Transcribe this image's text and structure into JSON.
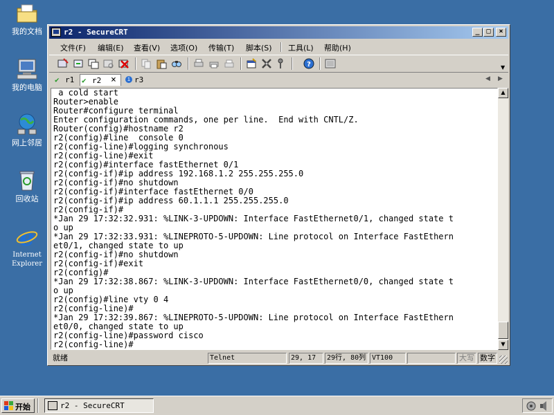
{
  "desktop": {
    "icons": [
      {
        "label": "我的文档",
        "icon": "my-documents-folder-icon"
      },
      {
        "label": "我的电脑",
        "icon": "my-computer-icon"
      },
      {
        "label": "网上邻居",
        "icon": "network-places-icon"
      },
      {
        "label": "回收站",
        "icon": "recycle-bin-icon"
      },
      {
        "label": "Internet Explorer",
        "icon": "internet-explorer-icon"
      }
    ]
  },
  "window": {
    "title": "r2 - SecureCRT",
    "buttons": {
      "minimize": "_",
      "maximize": "□",
      "close": "×"
    },
    "menu": [
      "文件(F)",
      "编辑(E)",
      "查看(V)",
      "选项(O)",
      "传输(T)",
      "脚本(S)",
      "工具(L)",
      "帮助(H)"
    ],
    "toolbar_icons": [
      "connect-icon",
      "quick-connect-icon",
      "connect-in-tab-icon",
      "reconnect-icon",
      "disconnect-icon",
      "copy-icon",
      "paste-icon",
      "find-icon",
      "print-icon",
      "print-selection-icon",
      "print-setup-icon",
      "session-options-icon",
      "global-options-icon",
      "keymap-icon",
      "help-icon",
      "sftp-icon"
    ],
    "tabs": [
      {
        "label": "r1",
        "status": "connected"
      },
      {
        "label": "r2",
        "status": "connected",
        "active": true
      },
      {
        "label": "r3",
        "status": "info"
      }
    ],
    "tab_close": "×",
    "tab_scroll": {
      "left": "◀",
      "right": "▶"
    }
  },
  "terminal": {
    "lines": [
      " a cold start",
      "Router>enable",
      "Router#configure terminal",
      "Enter configuration commands, one per line.  End with CNTL/Z.",
      "Router(config)#hostname r2",
      "r2(config)#line  console 0",
      "r2(config-line)#logging synchronous",
      "r2(config-line)#exit",
      "r2(config)#interface fastEthernet 0/1",
      "r2(config-if)#ip address 192.168.1.2 255.255.255.0",
      "r2(config-if)#no shutdown",
      "r2(config-if)#interface fastEthernet 0/0",
      "r2(config-if)#ip address 60.1.1.1 255.255.255.0",
      "r2(config-if)#",
      "*Jan 29 17:32:32.931: %LINK-3-UPDOWN: Interface FastEthernet0/1, changed state t",
      "o up",
      "*Jan 29 17:32:33.931: %LINEPROTO-5-UPDOWN: Line protocol on Interface FastEthern",
      "et0/1, changed state to up",
      "r2(config-if)#no shutdown",
      "r2(config-if)#exit",
      "r2(config)#",
      "*Jan 29 17:32:38.867: %LINK-3-UPDOWN: Interface FastEthernet0/0, changed state t",
      "o up",
      "r2(config)#line vty 0 4",
      "r2(config-line)#",
      "*Jan 29 17:32:39.867: %LINEPROTO-5-UPDOWN: Line protocol on Interface FastEthern",
      "et0/0, changed state to up",
      "r2(config-line)#password cisco",
      "r2(config-line)#"
    ]
  },
  "status": {
    "ready": "就绪",
    "protocol": "Telnet",
    "cursor": "29, 17",
    "size": "29行, 80列",
    "emulation": "VT100",
    "blank": "",
    "caps": "大写",
    "num": "数字"
  },
  "taskbar": {
    "start": "开始",
    "task_label": "r2 - SecureCRT",
    "tray_icons": [
      "network-tray-icon",
      "volume-tray-icon"
    ]
  },
  "colors": {
    "desktop": "#3a6ea5",
    "title_active_start": "#0a246a",
    "title_active_end": "#a6caf0"
  }
}
